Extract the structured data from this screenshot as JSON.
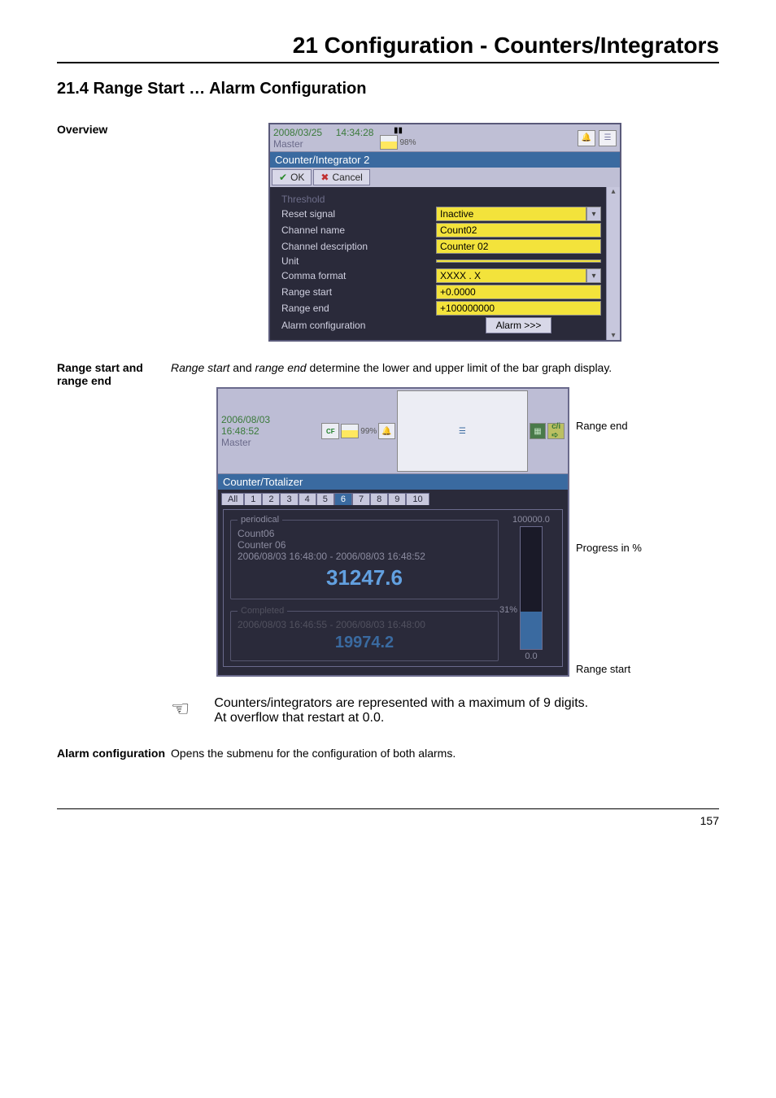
{
  "chapter_title": "21 Configuration - Counters/Integrators",
  "section_head": "21.4   Range Start … Alarm Configuration",
  "overview_label": "Overview",
  "range_label": "Range start and range end",
  "range_text_prefix": "Range start",
  "range_text_mid": " and ",
  "range_text_italic2": "range end",
  "range_text_suffix": " determine the lower and upper limit of the bar graph display.",
  "note_line1": "Counters/integrators are represented with a maximum of 9 digits.",
  "note_line2": "At overflow that restart at 0.0.",
  "alarm_label": "Alarm configuration",
  "alarm_text": "Opens the submenu for the configuration of both alarms.",
  "page_number": "157",
  "dlg": {
    "date": "2008/03/25",
    "time": "14:34:28",
    "master": "Master",
    "pct": "98%",
    "title2": "Counter/Integrator 2",
    "ok": "OK",
    "cancel": "Cancel",
    "rows": {
      "threshold": "Threshold",
      "reset": "Reset signal",
      "reset_val": "Inactive",
      "chname": "Channel name",
      "chname_val": "Count02",
      "chdesc": "Channel description",
      "chdesc_val": "Counter 02",
      "unit": "Unit",
      "unit_val": "",
      "comma": "Comma format",
      "comma_val": "XXXX . X",
      "rstart": "Range start",
      "rstart_val": "+0.0000",
      "rend": "Range end",
      "rend_val": "+100000000",
      "alarm": "Alarm configuration",
      "alarm_btn": "Alarm >>>"
    }
  },
  "viz": {
    "date": "2006/08/03",
    "time": "16:48:52",
    "master": "Master",
    "pct": "99%",
    "title2": "Counter/Totalizer",
    "tabs": [
      "All",
      "1",
      "2",
      "3",
      "4",
      "5",
      "6",
      "7",
      "8",
      "9",
      "10"
    ],
    "tab_active_index": 6,
    "periodical": {
      "legend": "periodical",
      "name": "Count06",
      "desc": "Counter 06",
      "range": "2006/08/03 16:48:00 - 2006/08/03 16:48:52",
      "value": "31247.6"
    },
    "completed": {
      "legend": "Completed",
      "range": "2006/08/03 16:46:55   -   2006/08/03 16:48:00",
      "value": "19974.2"
    },
    "bar": {
      "top": "100000.0",
      "mid": "31%",
      "bottom": "0.0",
      "fill_pct": 31
    },
    "callouts": {
      "top": "Range end",
      "mid": "Progress in %",
      "bottom": "Range start"
    }
  },
  "chart_data": {
    "type": "bar",
    "title": "Counter progress bargraph",
    "categories": [
      "Count06"
    ],
    "values": [
      31247.6
    ],
    "ylim": [
      0,
      100000
    ],
    "ylabel": "",
    "xlabel": "",
    "percent": 31
  }
}
